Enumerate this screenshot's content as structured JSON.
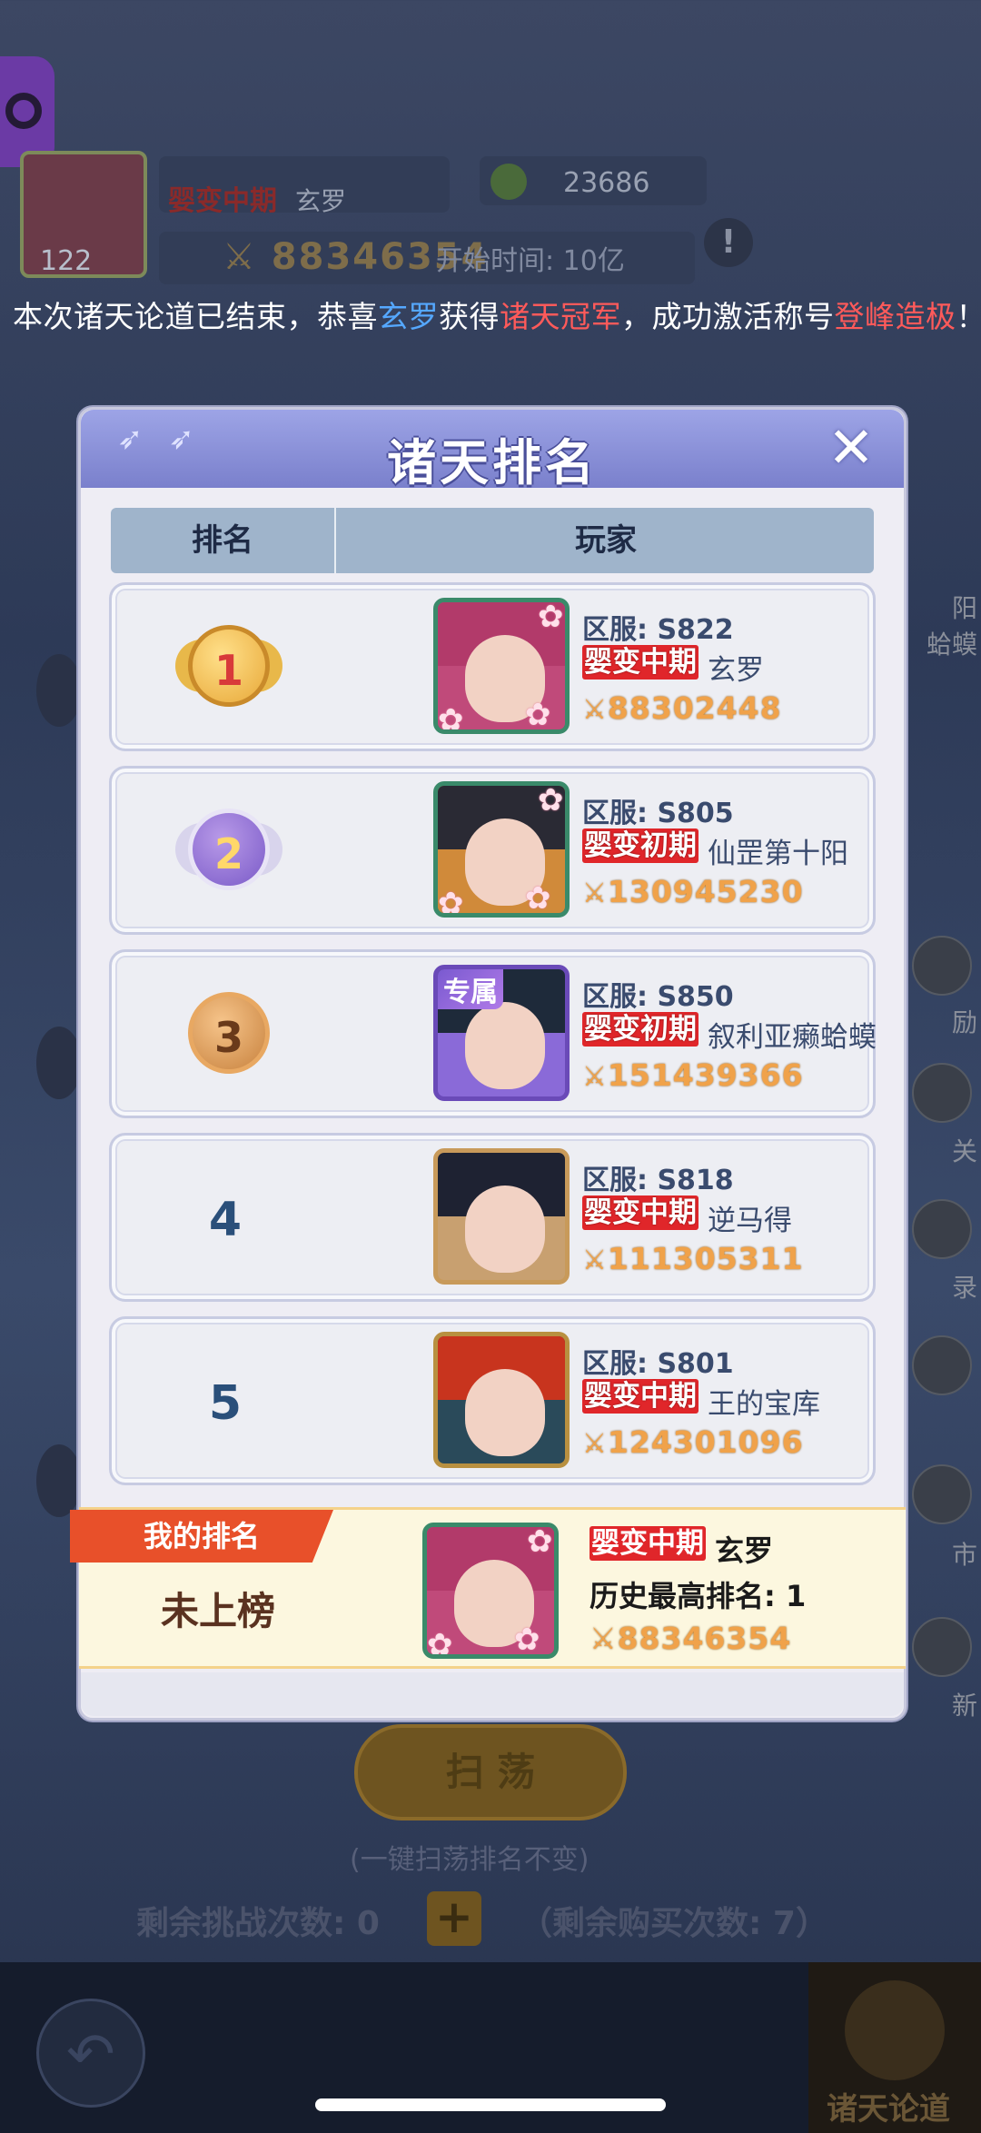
{
  "background": {
    "level": "122",
    "realm": "婴变中期",
    "name": "玄罗",
    "coins": "23686",
    "power": "88346354",
    "start_text": "开始时间: 10亿",
    "sweep_button": "扫 荡",
    "sweep_note": "(一键扫荡排名不变)",
    "remaining_challenges": "剩余挑战次数: 0",
    "remaining_buys": "（剩余购买次数: 7）",
    "corner_label": "诸天论道",
    "right_labels": [
      "阳",
      "蛤蟆",
      "励",
      "关",
      "录",
      "市",
      "新"
    ]
  },
  "announcement": {
    "prefix": "本次诸天论道已结束，恭喜",
    "player": "玄罗",
    "middle": "获得",
    "award": "诸天冠军",
    "middle2": "，成功激活称号",
    "title": "登峰造极",
    "suffix": "！"
  },
  "panel": {
    "title": "诸天排名",
    "close_glyph": "✕",
    "col_rank": "排名",
    "col_player": "玩家"
  },
  "rows": [
    {
      "rank": "1",
      "server": "区服: S822",
      "realm": "婴变中期",
      "name": "玄罗",
      "power": "88302448",
      "exclusive": ""
    },
    {
      "rank": "2",
      "server": "区服: S805",
      "realm": "婴变初期",
      "name": "仙罡第十阳",
      "power": "130945230",
      "exclusive": ""
    },
    {
      "rank": "3",
      "server": "区服: S850",
      "realm": "婴变初期",
      "name": "叙利亚癞蛤蟆",
      "power": "151439366",
      "exclusive": "专属"
    },
    {
      "rank": "4",
      "server": "区服: S818",
      "realm": "婴变中期",
      "name": "逆马得",
      "power": "111305311",
      "exclusive": ""
    },
    {
      "rank": "5",
      "server": "区服: S801",
      "realm": "婴变中期",
      "name": "王的宝库",
      "power": "124301096",
      "exclusive": ""
    }
  ],
  "my_rank": {
    "ribbon": "我的排名",
    "status": "未上榜",
    "realm": "婴变中期",
    "name": "玄罗",
    "best": "历史最高排名: 1",
    "power": "88346354"
  },
  "colors": {
    "realm_badge": "#e0262a",
    "power": "#f0a24a",
    "announce_blue": "#55a8ff",
    "announce_red": "#ff5a5a",
    "header": "#7a80cc",
    "gold_medal": "#e8a838",
    "silver_medal": "#8a6acc",
    "bronze_medal": "#d08a4a"
  },
  "icons": {
    "sword": "crossed-swords-icon",
    "close": "close-icon",
    "back": "back-arrow-icon"
  }
}
